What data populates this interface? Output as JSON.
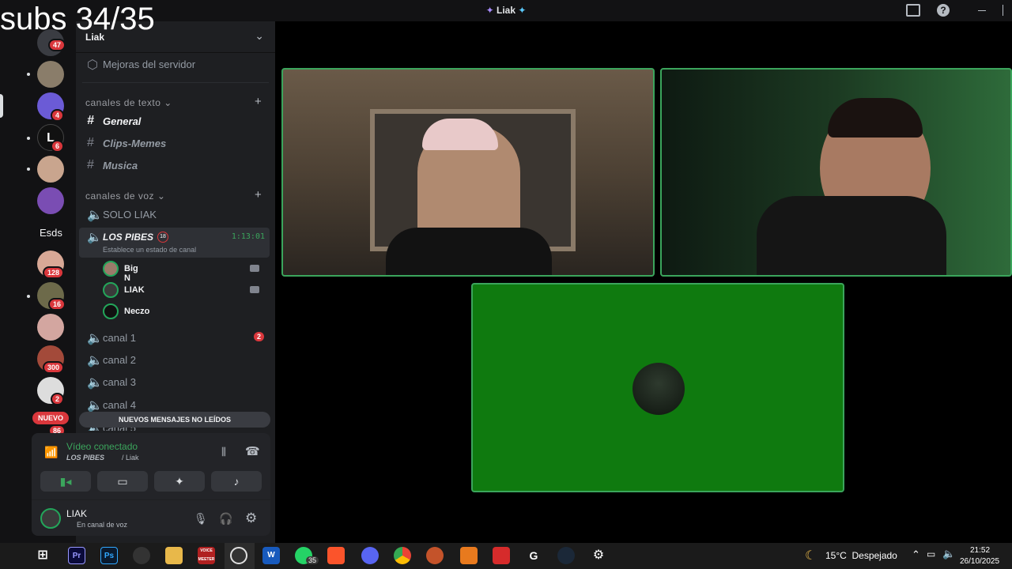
{
  "overlay": {
    "text": "subs 34/35"
  },
  "window": {
    "title": "Liak"
  },
  "rail": {
    "badges": [
      "47",
      "4",
      "6",
      "128",
      "16",
      "300",
      "2",
      "86"
    ],
    "folder_label": "Esds",
    "new_label": "NUEVO"
  },
  "server": {
    "name": "Liak",
    "boost_label": "Mejoras del servidor",
    "text_header": "canales de texto",
    "voice_header": "canales de voz",
    "text_channels": [
      "General",
      "Clips-Memes",
      "Musica"
    ],
    "voice_channels": {
      "solo": "SOLO LIAK",
      "active": "LOS PIBES",
      "active_timer": "1:13:01",
      "active_status": "Establece un estado de canal",
      "members": [
        "Big N",
        "LIAK",
        "Neczo"
      ],
      "others": [
        "canal 1",
        "canal 2",
        "canal 3",
        "canal 4",
        "canal 5"
      ],
      "canal1_badge": "2"
    },
    "unread_banner": "NUEVOS MENSAJES NO LEÍDOS"
  },
  "voice": {
    "status": "Vídeo conectado",
    "location": "LOS PIBES",
    "location_server": "/ Liak"
  },
  "user": {
    "name": "LIAK",
    "status": "En canal de voz"
  },
  "taskbar": {
    "weather": "15°C  Despejado",
    "time": "21:52",
    "date": "26/10/2025",
    "whatsapp_badge": "35",
    "labels": {
      "pr": "Pr",
      "ps": "Ps",
      "vm": "VOICE MEETER",
      "w": "W"
    }
  },
  "colors": {
    "green": "#3ba55c",
    "red": "#da373c",
    "bg_sidebar": "#1e1f22"
  }
}
